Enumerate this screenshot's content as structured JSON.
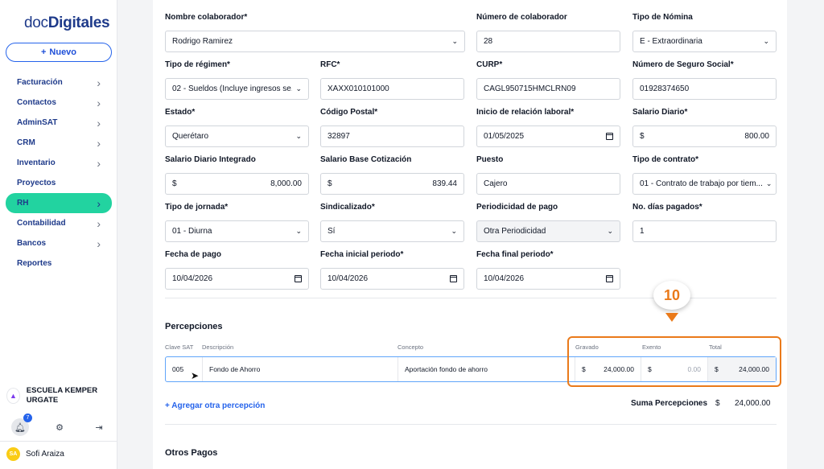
{
  "sidebar": {
    "logo_light": "doc",
    "logo_bold": "Digitales",
    "new_button": "Nuevo",
    "items": [
      {
        "label": "Facturación",
        "has_chevron": true
      },
      {
        "label": "Contactos",
        "has_chevron": true
      },
      {
        "label": "AdminSAT",
        "has_chevron": true
      },
      {
        "label": "CRM",
        "has_chevron": true
      },
      {
        "label": "Inventario",
        "has_chevron": true
      },
      {
        "label": "Proyectos",
        "has_chevron": false
      },
      {
        "label": "RH",
        "has_chevron": true,
        "active": true
      },
      {
        "label": "Contabilidad",
        "has_chevron": true
      },
      {
        "label": "Bancos",
        "has_chevron": true
      },
      {
        "label": "Reportes",
        "has_chevron": false
      }
    ],
    "company": "ESCUELA KEMPER URGATE",
    "notifications_count": "7",
    "user_initials": "SA",
    "user_name": "Sofi Araiza",
    "accent_color": "#22d3a0"
  },
  "form": {
    "nombre_colaborador": {
      "label": "Nombre colaborador*",
      "value": "Rodrigo Ramirez"
    },
    "numero_colaborador": {
      "label": "Número de colaborador",
      "value": "28"
    },
    "tipo_nomina": {
      "label": "Tipo de Nómina",
      "value": "E - Extraordinaria"
    },
    "tipo_regimen": {
      "label": "Tipo de régimen*",
      "value": "02 - Sueldos (Incluye ingresos se..."
    },
    "rfc": {
      "label": "RFC*",
      "value": "XAXX010101000"
    },
    "curp": {
      "label": "CURP*",
      "value": "CAGL950715HMCLRN09"
    },
    "nss": {
      "label": "Número de Seguro Social*",
      "value": "01928374650"
    },
    "estado": {
      "label": "Estado*",
      "value": "Querétaro"
    },
    "codigo_postal": {
      "label": "Código Postal*",
      "value": "32897"
    },
    "inicio_relacion": {
      "label": "Inicio de relación laboral*",
      "value": "01/05/2025"
    },
    "salario_diario": {
      "label": "Salario Diario*",
      "currency": "$",
      "value": "800.00"
    },
    "sdi": {
      "label": "Salario Diario Integrado",
      "currency": "$",
      "value": "8,000.00"
    },
    "sbc": {
      "label": "Salario Base Cotización",
      "currency": "$",
      "value": "839.44"
    },
    "puesto": {
      "label": "Puesto",
      "value": "Cajero"
    },
    "tipo_contrato": {
      "label": "Tipo de contrato*",
      "value": "01 - Contrato de trabajo por tiem..."
    },
    "tipo_jornada": {
      "label": "Tipo de jornada*",
      "value": "01 - Diurna"
    },
    "sindicalizado": {
      "label": "Sindicalizado*",
      "value": "Sí"
    },
    "periodicidad": {
      "label": "Periodicidad de pago",
      "value": "Otra Periodicidad"
    },
    "dias_pagados": {
      "label": "No. días pagados*",
      "value": "1"
    },
    "fecha_pago": {
      "label": "Fecha de pago",
      "value": "10/04/2026"
    },
    "fecha_inicial": {
      "label": "Fecha inicial periodo*",
      "value": "10/04/2026"
    },
    "fecha_final": {
      "label": "Fecha final periodo*",
      "value": "10/04/2026"
    }
  },
  "percepciones": {
    "title": "Percepciones",
    "headers": {
      "clave": "Clave SAT",
      "descripcion": "Descripción",
      "concepto": "Concepto",
      "gravado": "Gravado",
      "exento": "Exento",
      "total": "Total"
    },
    "row": {
      "clave": "005",
      "descripcion": "Fondo de Ahorro",
      "concepto": "Aportación fondo de ahorro",
      "currency": "$",
      "gravado": "24,000.00",
      "exento": "0.00",
      "total": "24,000.00"
    },
    "add_link": "+ Agregar otra percepción",
    "sum_label": "Suma Percepciones",
    "sum_currency": "$",
    "sum_value": "24,000.00"
  },
  "otros_pagos": {
    "title": "Otros Pagos"
  },
  "tutorial": {
    "step": "10",
    "color": "#ea7a1a"
  }
}
